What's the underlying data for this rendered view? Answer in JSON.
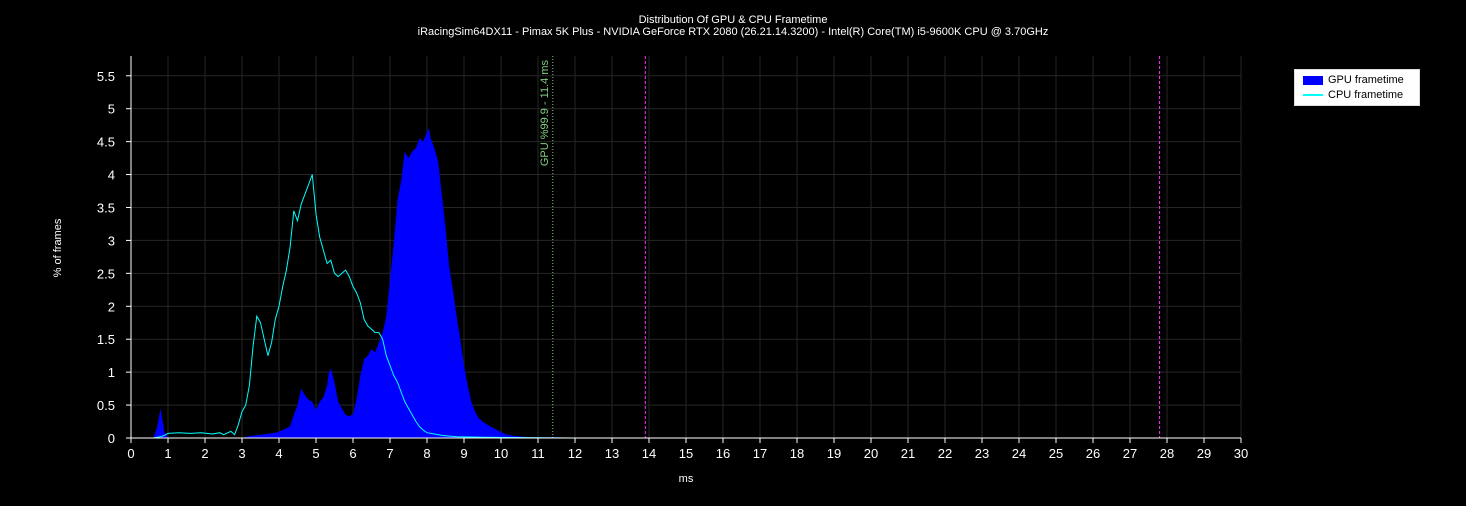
{
  "chart_data": {
    "type": "area",
    "title": "Distribution Of GPU & CPU Frametime",
    "subtitle": "iRacingSim64DX11 - Pimax 5K Plus - NVIDIA GeForce RTX 2080 (26.21.14.3200) - Intel(R) Core(TM) i5-9600K CPU @ 3.70GHz",
    "xlabel": "ms",
    "ylabel": "% of frames",
    "xlim": [
      0,
      30
    ],
    "ylim": [
      0,
      5.8
    ],
    "x_ticks": [
      0,
      1,
      2,
      3,
      4,
      5,
      6,
      7,
      8,
      9,
      10,
      11,
      12,
      13,
      14,
      15,
      16,
      17,
      18,
      19,
      20,
      21,
      22,
      23,
      24,
      25,
      26,
      27,
      28,
      29,
      30
    ],
    "y_ticks": [
      0,
      0.5,
      1,
      1.5,
      2,
      2.5,
      3,
      3.5,
      4,
      4.5,
      5,
      5.5
    ],
    "grid": true,
    "legend_position": "top-right",
    "series": [
      {
        "name": "GPU frametime",
        "kind": "area",
        "color": "#0000ff",
        "points": [
          [
            0,
            0
          ],
          [
            0.6,
            0
          ],
          [
            0.7,
            0.15
          ],
          [
            0.8,
            0.45
          ],
          [
            0.9,
            0.1
          ],
          [
            1.0,
            0
          ],
          [
            3.0,
            0
          ],
          [
            3.2,
            0.03
          ],
          [
            3.5,
            0.05
          ],
          [
            3.9,
            0.08
          ],
          [
            4.1,
            0.12
          ],
          [
            4.3,
            0.18
          ],
          [
            4.4,
            0.35
          ],
          [
            4.5,
            0.5
          ],
          [
            4.6,
            0.75
          ],
          [
            4.7,
            0.65
          ],
          [
            4.8,
            0.58
          ],
          [
            4.9,
            0.55
          ],
          [
            5.0,
            0.42
          ],
          [
            5.1,
            0.55
          ],
          [
            5.2,
            0.62
          ],
          [
            5.3,
            0.8
          ],
          [
            5.35,
            1.0
          ],
          [
            5.4,
            1.05
          ],
          [
            5.5,
            0.85
          ],
          [
            5.6,
            0.55
          ],
          [
            5.7,
            0.45
          ],
          [
            5.8,
            0.35
          ],
          [
            5.9,
            0.33
          ],
          [
            6.0,
            0.36
          ],
          [
            6.1,
            0.6
          ],
          [
            6.2,
            0.95
          ],
          [
            6.3,
            1.2
          ],
          [
            6.4,
            1.25
          ],
          [
            6.5,
            1.35
          ],
          [
            6.6,
            1.3
          ],
          [
            6.7,
            1.45
          ],
          [
            6.8,
            1.6
          ],
          [
            6.9,
            1.85
          ],
          [
            7.0,
            2.4
          ],
          [
            7.1,
            2.95
          ],
          [
            7.2,
            3.6
          ],
          [
            7.3,
            3.9
          ],
          [
            7.4,
            4.35
          ],
          [
            7.5,
            4.25
          ],
          [
            7.6,
            4.35
          ],
          [
            7.7,
            4.4
          ],
          [
            7.8,
            4.55
          ],
          [
            7.9,
            4.5
          ],
          [
            8.0,
            4.65
          ],
          [
            8.05,
            4.7
          ],
          [
            8.1,
            4.55
          ],
          [
            8.2,
            4.4
          ],
          [
            8.3,
            4.2
          ],
          [
            8.4,
            3.7
          ],
          [
            8.5,
            3.2
          ],
          [
            8.6,
            2.6
          ],
          [
            8.7,
            2.25
          ],
          [
            8.8,
            1.85
          ],
          [
            8.9,
            1.5
          ],
          [
            9.0,
            1.1
          ],
          [
            9.1,
            0.8
          ],
          [
            9.2,
            0.55
          ],
          [
            9.3,
            0.4
          ],
          [
            9.4,
            0.3
          ],
          [
            9.5,
            0.25
          ],
          [
            9.7,
            0.18
          ],
          [
            9.9,
            0.12
          ],
          [
            10.1,
            0.06
          ],
          [
            10.4,
            0.03
          ],
          [
            10.8,
            0.01
          ],
          [
            11.5,
            0.01
          ],
          [
            12,
            0
          ]
        ]
      },
      {
        "name": "CPU frametime",
        "kind": "line",
        "color": "#00ffff",
        "points": [
          [
            0,
            0
          ],
          [
            0.6,
            0
          ],
          [
            0.8,
            0.02
          ],
          [
            0.9,
            0.04
          ],
          [
            1.0,
            0.07
          ],
          [
            1.3,
            0.08
          ],
          [
            1.6,
            0.07
          ],
          [
            1.9,
            0.08
          ],
          [
            2.2,
            0.06
          ],
          [
            2.4,
            0.08
          ],
          [
            2.5,
            0.05
          ],
          [
            2.7,
            0.1
          ],
          [
            2.8,
            0.05
          ],
          [
            2.9,
            0.2
          ],
          [
            3.0,
            0.4
          ],
          [
            3.1,
            0.5
          ],
          [
            3.2,
            0.8
          ],
          [
            3.3,
            1.4
          ],
          [
            3.4,
            1.85
          ],
          [
            3.5,
            1.75
          ],
          [
            3.6,
            1.5
          ],
          [
            3.7,
            1.25
          ],
          [
            3.8,
            1.45
          ],
          [
            3.9,
            1.8
          ],
          [
            4.0,
            2.0
          ],
          [
            4.1,
            2.3
          ],
          [
            4.2,
            2.55
          ],
          [
            4.3,
            2.9
          ],
          [
            4.4,
            3.45
          ],
          [
            4.5,
            3.3
          ],
          [
            4.6,
            3.55
          ],
          [
            4.7,
            3.7
          ],
          [
            4.8,
            3.85
          ],
          [
            4.9,
            4.0
          ],
          [
            5.0,
            3.4
          ],
          [
            5.1,
            3.05
          ],
          [
            5.2,
            2.85
          ],
          [
            5.3,
            2.65
          ],
          [
            5.4,
            2.7
          ],
          [
            5.5,
            2.5
          ],
          [
            5.6,
            2.45
          ],
          [
            5.7,
            2.5
          ],
          [
            5.8,
            2.55
          ],
          [
            5.9,
            2.45
          ],
          [
            6.0,
            2.3
          ],
          [
            6.1,
            2.2
          ],
          [
            6.2,
            2.05
          ],
          [
            6.3,
            1.8
          ],
          [
            6.4,
            1.7
          ],
          [
            6.5,
            1.65
          ],
          [
            6.6,
            1.6
          ],
          [
            6.7,
            1.6
          ],
          [
            6.8,
            1.5
          ],
          [
            6.9,
            1.25
          ],
          [
            7.0,
            1.1
          ],
          [
            7.1,
            0.95
          ],
          [
            7.2,
            0.85
          ],
          [
            7.3,
            0.7
          ],
          [
            7.4,
            0.55
          ],
          [
            7.5,
            0.45
          ],
          [
            7.6,
            0.35
          ],
          [
            7.7,
            0.25
          ],
          [
            7.8,
            0.17
          ],
          [
            7.9,
            0.12
          ],
          [
            8.0,
            0.08
          ],
          [
            8.2,
            0.06
          ],
          [
            8.4,
            0.04
          ],
          [
            8.8,
            0.02
          ],
          [
            9.5,
            0.01
          ],
          [
            12,
            0
          ]
        ]
      }
    ],
    "annotations": [
      {
        "x": 11.4,
        "label": "GPU %99.9 - 11.4 ms",
        "color": "#7fcf7f",
        "style": "dotted"
      },
      {
        "x": 13.9,
        "label": "",
        "color": "#ff33ff",
        "style": "dashed"
      },
      {
        "x": 27.8,
        "label": "",
        "color": "#ff33ff",
        "style": "dashed"
      }
    ]
  }
}
